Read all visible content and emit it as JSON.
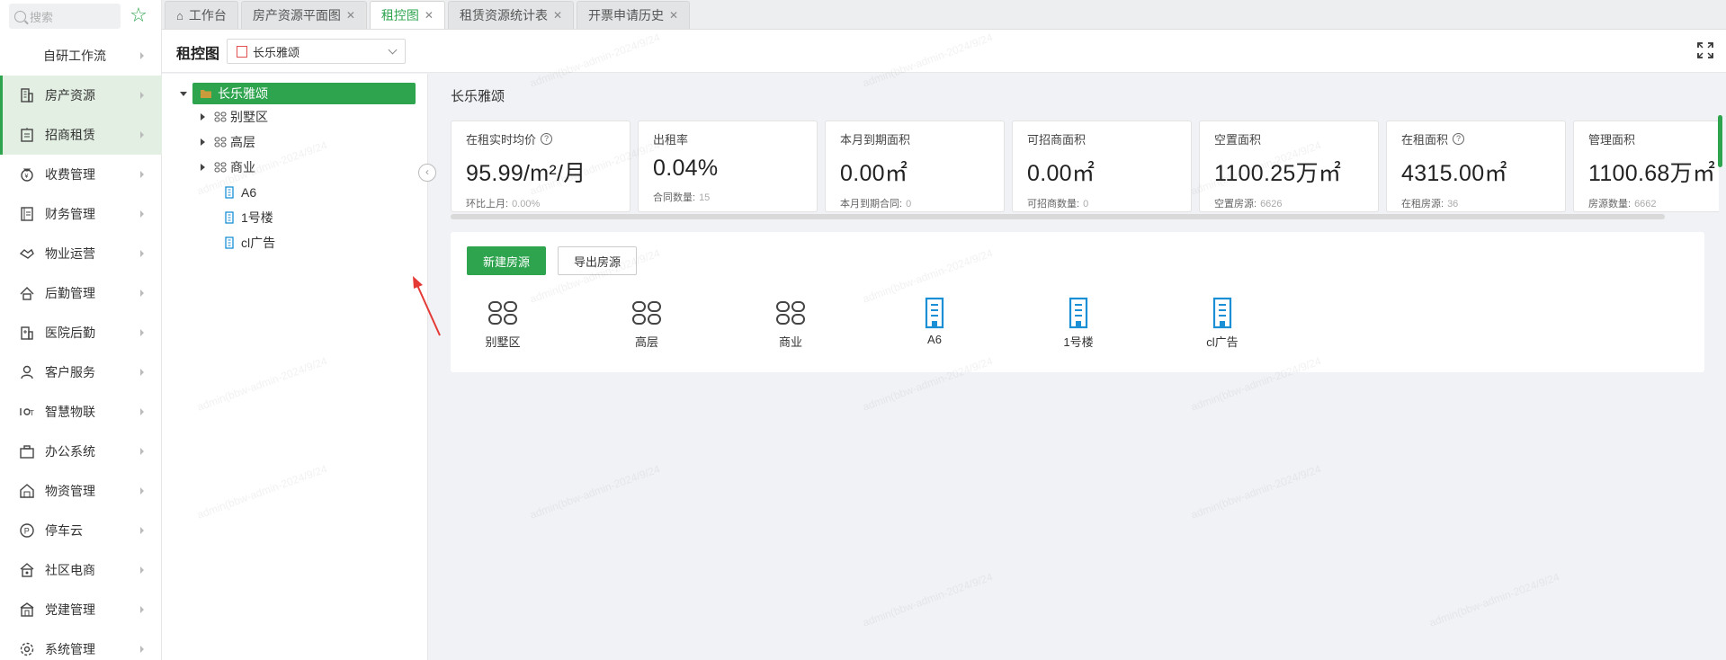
{
  "sidebar": {
    "search_placeholder": "搜索",
    "items": [
      {
        "label": "自研工作流",
        "icon": "none"
      },
      {
        "label": "房产资源",
        "icon": "building-icon"
      },
      {
        "label": "招商租赁",
        "icon": "lease-icon"
      },
      {
        "label": "收费管理",
        "icon": "money-bag-icon"
      },
      {
        "label": "财务管理",
        "icon": "ledger-icon"
      },
      {
        "label": "物业运营",
        "icon": "handshake-icon"
      },
      {
        "label": "后勤管理",
        "icon": "logistics-icon"
      },
      {
        "label": "医院后勤",
        "icon": "hospital-icon"
      },
      {
        "label": "客户服务",
        "icon": "user-icon"
      },
      {
        "label": "智慧物联",
        "icon": "iot-icon"
      },
      {
        "label": "办公系统",
        "icon": "briefcase-icon"
      },
      {
        "label": "物资管理",
        "icon": "warehouse-icon"
      },
      {
        "label": "停车云",
        "icon": "parking-icon"
      },
      {
        "label": "社区电商",
        "icon": "shop-icon"
      },
      {
        "label": "党建管理",
        "icon": "party-icon"
      },
      {
        "label": "系统管理",
        "icon": "gear-icon"
      }
    ]
  },
  "tabs": [
    {
      "label": "工作台",
      "closable": false,
      "home": true
    },
    {
      "label": "房产资源平面图",
      "closable": true
    },
    {
      "label": "租控图",
      "closable": true,
      "active": true
    },
    {
      "label": "租赁资源统计表",
      "closable": true
    },
    {
      "label": "开票申请历史",
      "closable": true
    }
  ],
  "header": {
    "title": "租控图",
    "project_select": "长乐雅颂"
  },
  "tree": {
    "root": "长乐雅颂",
    "children": [
      {
        "label": "别墅区",
        "type": "group"
      },
      {
        "label": "高层",
        "type": "group"
      },
      {
        "label": "商业",
        "type": "group"
      },
      {
        "label": "A6",
        "type": "building"
      },
      {
        "label": "1号楼",
        "type": "building"
      },
      {
        "label": "cl广告",
        "type": "building"
      }
    ]
  },
  "main": {
    "title": "长乐雅颂",
    "stats": [
      {
        "label": "在租实时均价",
        "help": true,
        "value": "95.99/m²/月",
        "sub_label": "环比上月:",
        "sub_value": "0.00%"
      },
      {
        "label": "出租率",
        "help": false,
        "value": "0.04%",
        "sub_label": "合同数量:",
        "sub_value": "15"
      },
      {
        "label": "本月到期面积",
        "help": false,
        "value": "0.00㎡",
        "sub_label": "本月到期合同:",
        "sub_value": "0"
      },
      {
        "label": "可招商面积",
        "help": false,
        "value": "0.00㎡",
        "sub_label": "可招商数量:",
        "sub_value": "0"
      },
      {
        "label": "空置面积",
        "help": false,
        "value": "1100.25万㎡",
        "sub_label": "空置房源:",
        "sub_value": "6626"
      },
      {
        "label": "在租面积",
        "help": true,
        "value": "4315.00㎡",
        "sub_label": "在租房源:",
        "sub_value": "36"
      },
      {
        "label": "管理面积",
        "help": false,
        "value": "1100.68万㎡",
        "sub_label": "房源数量:",
        "sub_value": "6662"
      }
    ],
    "new_button": "新建房源",
    "export_button": "导出房源",
    "buildings": [
      {
        "label": "别墅区",
        "icon": "group-icon"
      },
      {
        "label": "高层",
        "icon": "group-icon"
      },
      {
        "label": "商业",
        "icon": "group-icon"
      },
      {
        "label": "A6",
        "icon": "building-icon"
      },
      {
        "label": "1号楼",
        "icon": "building-icon"
      },
      {
        "label": "cl广告",
        "icon": "building-icon"
      }
    ]
  },
  "watermark": "admin(bbw-admin-2024/9/24",
  "colors": {
    "accent": "#2ea44f",
    "building_blue": "#1a8fd6",
    "arrow_red": "#e53935"
  }
}
